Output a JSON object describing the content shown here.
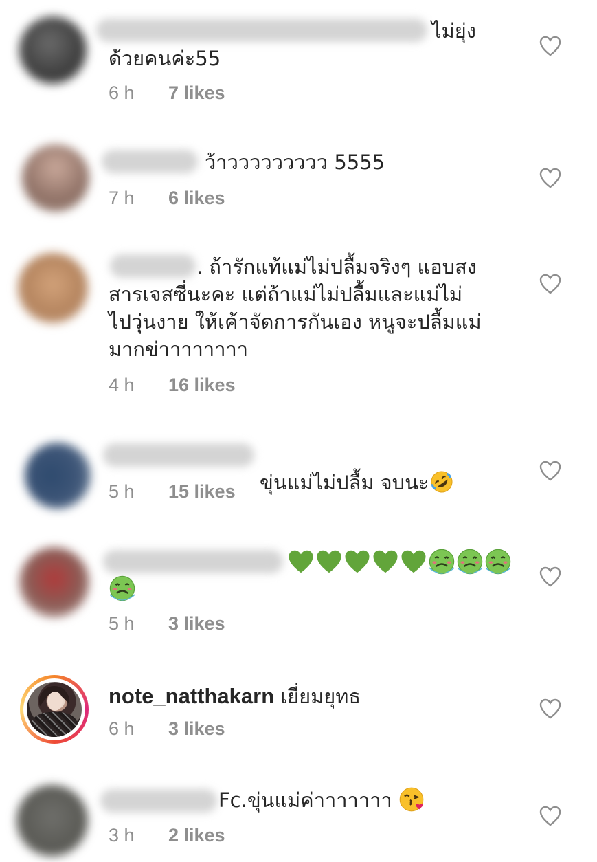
{
  "comments": [
    {
      "username_hidden": true,
      "text": "ไม่ยุ่ง\nด้วยคนค่ะ55",
      "time": "6 h",
      "likes": "7 likes"
    },
    {
      "username_hidden": true,
      "text": "ว้าววววววววว 5555",
      "time": "7 h",
      "likes": "6 likes"
    },
    {
      "username_hidden": true,
      "text": ". ถ้ารักแท้แม่ไม่ปลื้มจริงๆ แอบสง\nสารเจสซี่นะคะ แต่ถ้าแม่ไม่ปลื้มและแม่ไม่\nไปวุ่นงาย ให้เค้าจัดการกันเอง หนูจะปลื้มแม่\nมากข่าาาาาาาา",
      "time": "4 h",
      "likes": "16 likes"
    },
    {
      "username_hidden": true,
      "text": "ขุ่นแม่ไม่ปลื้ม จบนะ",
      "emoji": "rolling-on-floor-laughing-emoji",
      "time": "5 h",
      "likes": "15 likes"
    },
    {
      "username_hidden": true,
      "emoji_sequence": [
        "green-heart",
        "green-heart",
        "green-heart",
        "green-heart",
        "green-heart",
        "nauseated-face",
        "nauseated-face",
        "nauseated-face",
        "nauseated-face"
      ],
      "time": "5 h",
      "likes": "3 likes"
    },
    {
      "username": "note_natthakarn",
      "text": "เยี่ยมยุทธ",
      "time": "6 h",
      "likes": "3 likes"
    },
    {
      "username_hidden": true,
      "text": "Fc.ขุ่นแม่ค่าาาาาาา ",
      "emoji": "face-blowing-kiss-emoji",
      "time": "3 h",
      "likes": "2 likes"
    }
  ],
  "colors": {
    "text": "#262626",
    "meta": "#8e8e8e",
    "heart_outline": "#8e8e8e",
    "green_heart": "#62a53a",
    "nauseated": "#7cc653"
  },
  "icons": {
    "like": "heart-outline-icon"
  }
}
